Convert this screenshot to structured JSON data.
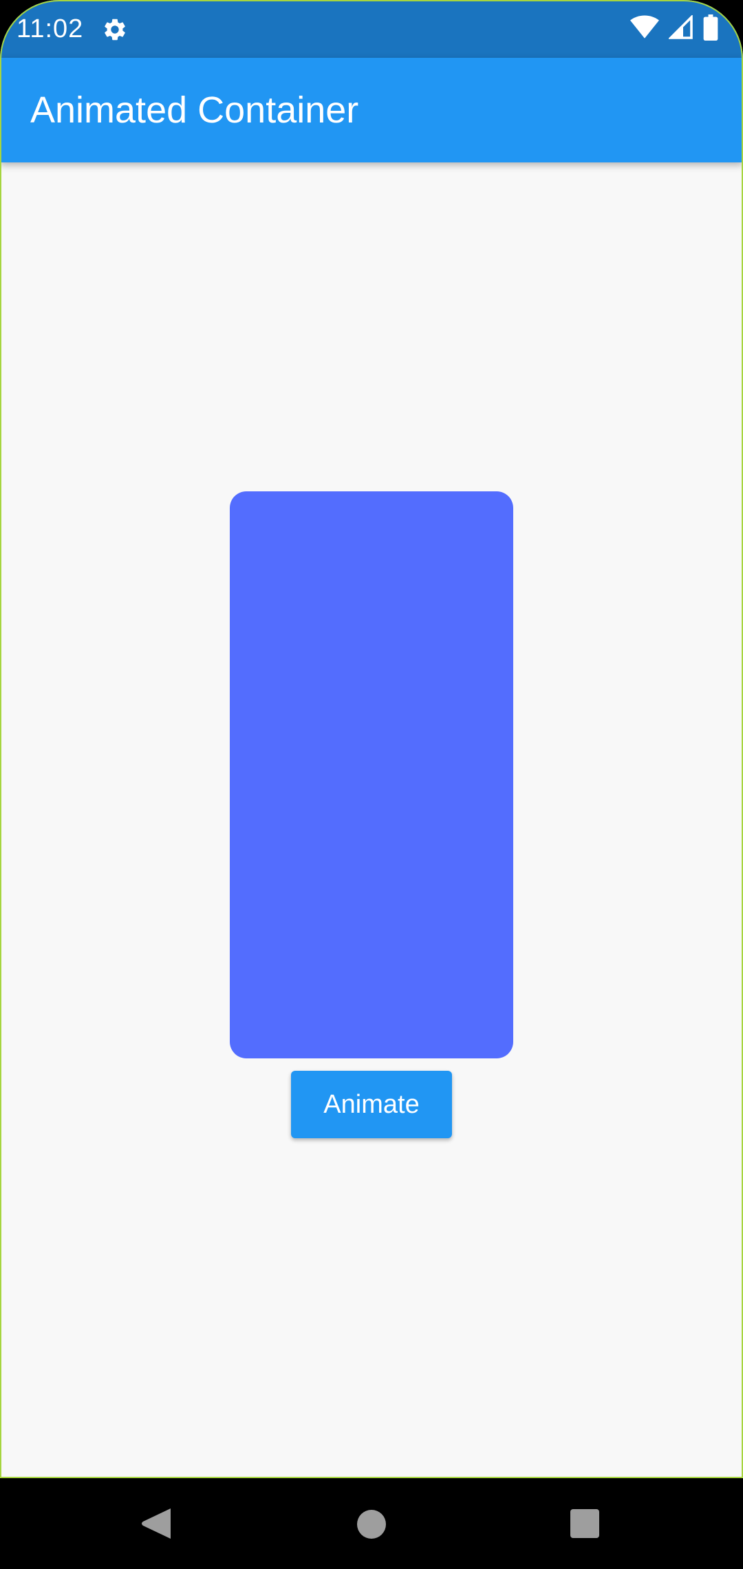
{
  "status_bar": {
    "time": "11:02",
    "icons": [
      "settings-gear-icon",
      "wifi-icon",
      "cellular-signal-icon",
      "battery-icon"
    ],
    "background_color": "#1a74bf"
  },
  "app_bar": {
    "title": "Animated Container",
    "background_color": "#2196f3"
  },
  "content": {
    "animated_container_color": "#536dfe",
    "animate_button_label": "Animate",
    "background_color": "#f8f8f8"
  },
  "nav_bar": {
    "icons": [
      "back-icon",
      "home-icon",
      "recents-icon"
    ]
  }
}
